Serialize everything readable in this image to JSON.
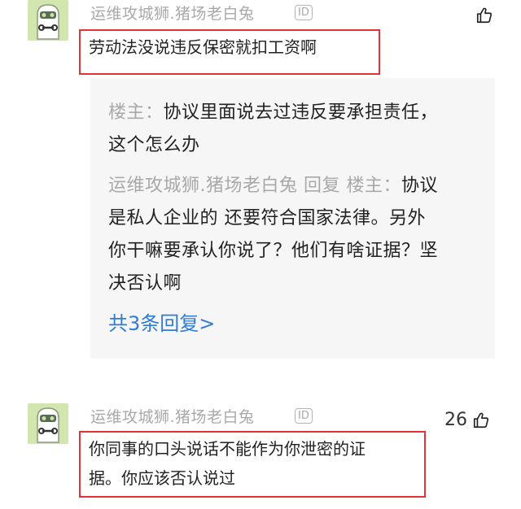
{
  "comments": [
    {
      "username": "运维攻城狮.猪场老白兔",
      "badge": "ID",
      "text": "劳动法没说违反保密就扣工资啊",
      "like_count": ""
    },
    {
      "username": "运维攻城狮.猪场老白兔",
      "badge": "ID",
      "text_line1": "你同事的口头说话不能作为你泄密的证",
      "text_line2": "据。你应该否认说过",
      "like_count": "26"
    }
  ],
  "replies": [
    {
      "author": "楼主：",
      "line1": "协议里面说去过违反要承担责任，",
      "line2": "这个怎么办"
    },
    {
      "author": "运维攻城狮.猪场老白兔 回复 楼主：",
      "line1": "协议",
      "line2": "是私人企业的 还要符合国家法律。另外",
      "line3": "你干嘛要承认你说了？他们有啥证据？坚",
      "line4": "决否认啊"
    }
  ],
  "more_replies_label": "共3条回复>",
  "colors": {
    "highlight_border": "#e0343a",
    "link": "#2f7bd6",
    "muted": "#a9a9a9",
    "avatar_bg": "#d4e6b0"
  }
}
